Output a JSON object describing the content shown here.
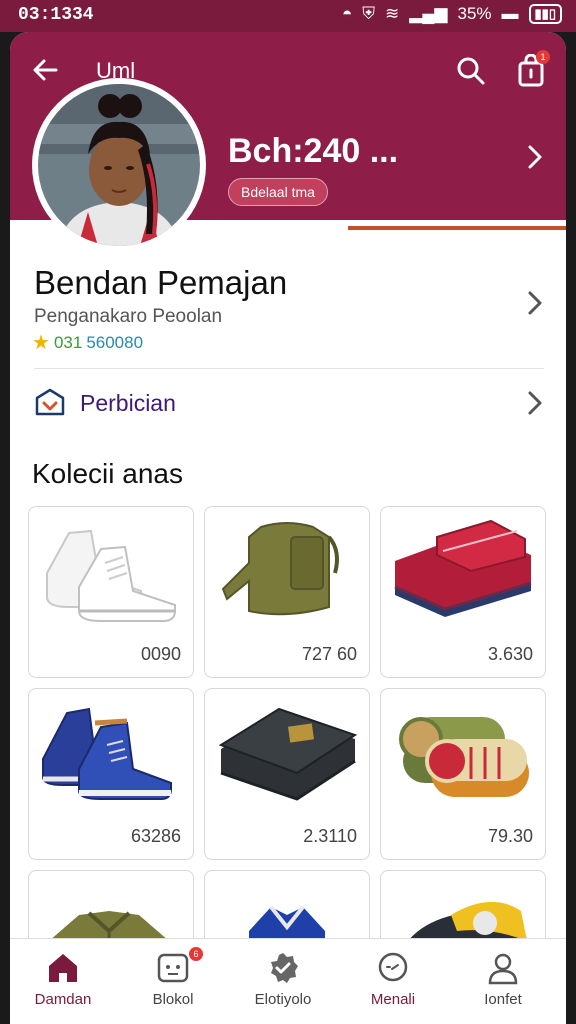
{
  "status_bar": {
    "time": "03:1334",
    "battery": "35%"
  },
  "header": {
    "title": "Uml",
    "stat_value": "Bch:240 ...",
    "stat_tag": "Bdelaal tma",
    "cart_badge": "1"
  },
  "profile": {
    "name": "Bendan Pemajan",
    "subtitle": "Penganakaro Peoolan",
    "rating_a": "031",
    "rating_b": "560080"
  },
  "service": {
    "label": "Perbician"
  },
  "collection": {
    "title": "Kolecii anas",
    "products": [
      {
        "name": "white-sneakers",
        "price": "0090"
      },
      {
        "name": "olive-vest",
        "price": "727 60"
      },
      {
        "name": "red-folded-bag",
        "price": "3.630"
      },
      {
        "name": "blue-sneakers",
        "price": "63286"
      },
      {
        "name": "black-wallet",
        "price": "2.3110"
      },
      {
        "name": "rolled-towels",
        "price": "79.30"
      },
      {
        "name": "olive-jacket",
        "price": ""
      },
      {
        "name": "blue-shirt",
        "price": ""
      },
      {
        "name": "yellow-cap",
        "price": ""
      }
    ]
  },
  "bottom_nav": {
    "items": [
      {
        "label": "Damdan",
        "icon": "home-icon",
        "active": true
      },
      {
        "label": "Blokol",
        "icon": "chat-icon",
        "badge": "6"
      },
      {
        "label": "Elotiyolo",
        "icon": "check-icon"
      },
      {
        "label": "Menali",
        "icon": "message-icon"
      },
      {
        "label": "Ionfet",
        "icon": "user-icon"
      }
    ]
  },
  "colors": {
    "primary": "#8e1d47",
    "accent": "#c4502a",
    "service_text": "#3d1a78"
  }
}
